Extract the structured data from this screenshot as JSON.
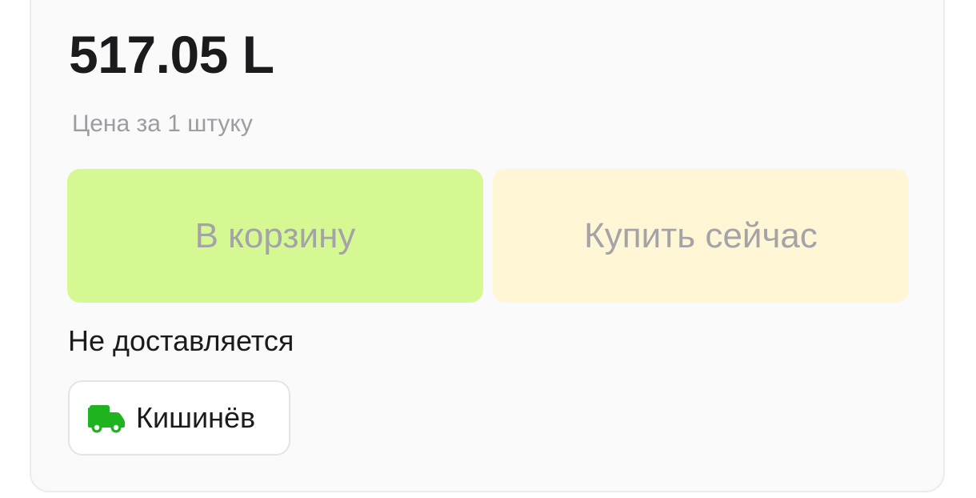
{
  "price": {
    "amount": "517.05 L",
    "note": "Цена за 1 штуку"
  },
  "actions": {
    "add_to_cart_label": "В корзину",
    "buy_now_label": "Купить сейчас"
  },
  "delivery": {
    "status": "Не доставляется",
    "city": "Кишинёв",
    "city_icon": "truck-icon"
  },
  "colors": {
    "add_to_cart_bg": "#d6f893",
    "buy_now_bg": "#fef6d4",
    "truck_icon": "#1fb31f"
  }
}
